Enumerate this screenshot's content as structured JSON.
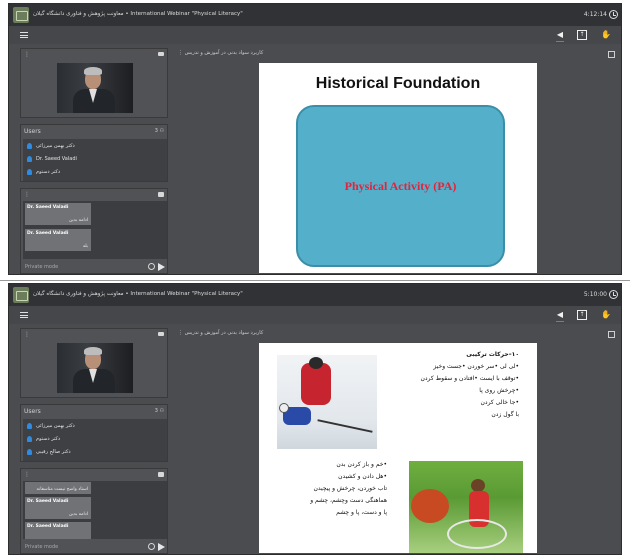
{
  "frames": [
    {
      "title": "معاونت پژوهش و فناوری دانشگاه گیلان • International Webinar \"Physical Literacy\"",
      "time": "4:12:14",
      "sections": {
        "users": "Users",
        "chat_placeholder": "Private mode"
      },
      "main_header": "کاربرد سواد بدنی در آموزش و تدریس",
      "users_count": "3",
      "users": [
        "دکتر بهمن میرزائی",
        "Dr. Saeed Valadi",
        "دکتر دستوم"
      ],
      "messages": [
        {
          "author": "Dr. Saeed Valadi",
          "text": "ادامه بدین"
        },
        {
          "author": "Dr. Saeed Valadi",
          "text": "بله"
        }
      ],
      "slide": {
        "title": "Historical Foundation",
        "box_text": "Physical Activity (PA)"
      }
    },
    {
      "title": "معاونت پژوهش و فناوری دانشگاه گیلان • International Webinar \"Physical Literacy\"",
      "time": "5:10:00",
      "sections": {
        "users": "Users",
        "chat_placeholder": "Private mode"
      },
      "main_header": "کاربرد سواد بدنی در آموزش و تدریس",
      "users_count": "3",
      "users": [
        "دکتر بهمن میرزائی",
        "دکتر دستوم",
        "دکتر صالح رقیبی"
      ],
      "messages": [
        {
          "author": "",
          "text": "استاد واضح نیست متاسفانه"
        },
        {
          "author": "Dr. Saeed Valadi",
          "text": "ادامه بدین"
        },
        {
          "author": "Dr. Saeed Valadi",
          "text": ""
        }
      ],
      "slide": {
        "heading": "۱۰–حرکات ترکیبی",
        "lines_right": [
          "•لی لی •سر خوردن •جست وخیز",
          "•توقف با ایست •افتادن و سقوط کردن",
          "•چرخش روی پا",
          "•جا خالی کردن",
          "با گول زدن"
        ],
        "lines_left": [
          "•خم و باز کردن بدن",
          "•هل دادن و کشیدن",
          "تاب خوردن، چرخش و پیچیدن",
          "هماهنگی دست وچشم، چشم و",
          "پا و دست، پا و چشم"
        ]
      }
    }
  ]
}
